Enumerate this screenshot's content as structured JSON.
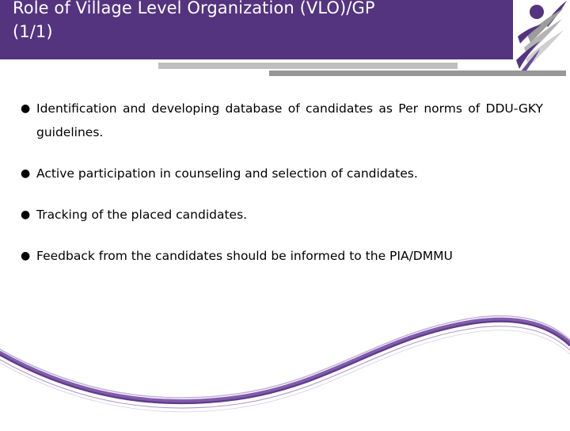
{
  "slide": {
    "title": "Role of Village Level Organization (VLO)/GP\n(1/1)",
    "header_color": "#54347E",
    "divider_light_color": "#BFBFBF",
    "divider_dark_color": "#979797",
    "text_color": "#000000",
    "background_color": "#FFFFFF"
  },
  "logo": {
    "name": "running-figure-logo",
    "primary_color": "#54347E",
    "secondary_color": "#A8A8A8"
  },
  "bullets": [
    {
      "glyph": "●",
      "text": "Identification and developing database of candidates as Per norms of DDU-GKY guidelines.",
      "multiline": true
    },
    {
      "glyph": "●",
      "text": "Active participation in counseling and selection of candidates.",
      "multiline": false
    },
    {
      "glyph": "●",
      "text": "Tracking of the placed candidates.",
      "multiline": false
    },
    {
      "glyph": "●",
      "text": "Feedback from the candidates should be informed to the PIA/DMMU",
      "multiline": true
    }
  ],
  "decoration": {
    "wave_name": "purple-wave-ribbon",
    "wave_color": "#7B52A8",
    "wave_accent_color": "#54347E"
  }
}
